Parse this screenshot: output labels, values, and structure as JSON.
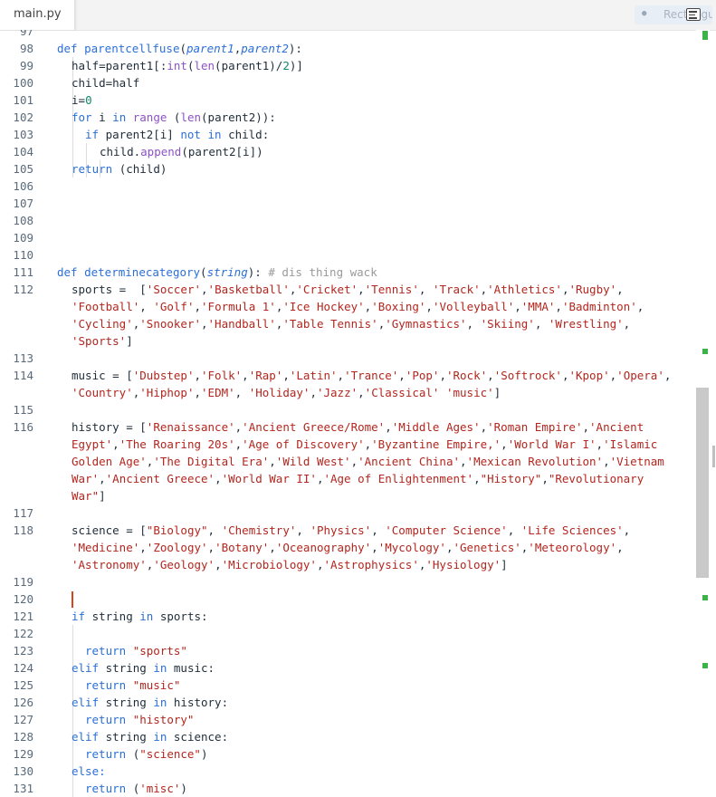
{
  "tabs": [
    {
      "label": "main.py",
      "active": true
    }
  ],
  "mini_pill_label": "Rectangula",
  "colors": {
    "keyword": "#2b6fd6",
    "string": "#b3261e",
    "number": "#0e8a6a",
    "builtin": "#8c52c7",
    "comment": "#9a9a9a",
    "cursor": "#d9421a",
    "marker": "#3cb34a"
  },
  "line_numbers": [
    "97",
    "98",
    "99",
    "100",
    "101",
    "102",
    "103",
    "104",
    "105",
    "106",
    "107",
    "108",
    "109",
    "110",
    "111",
    "112",
    "113",
    "114",
    "115",
    "116",
    "117",
    "118",
    "119",
    "120",
    "121",
    "122",
    "123",
    "124",
    "125",
    "126",
    "127",
    "128",
    "129",
    "130",
    "131"
  ],
  "code": {
    "l98": [
      "def ",
      "parentcellfuse",
      "(",
      "parent1",
      ",",
      "parent2",
      "):"
    ],
    "l99": [
      "half=parent1[:",
      "int",
      "(",
      "len",
      "(parent1)/",
      "2",
      ")]"
    ],
    "l100": [
      "child=half"
    ],
    "l101": [
      "i=",
      "0"
    ],
    "l102": [
      "for ",
      "i ",
      "in ",
      "range",
      " (",
      "len",
      "(parent2)):"
    ],
    "l103": [
      "if ",
      "parent2[i] ",
      "not in ",
      "child:"
    ],
    "l104": [
      "child.",
      "append",
      "(parent2[i])"
    ],
    "l105": [
      "return ",
      "(child)"
    ],
    "l111": [
      "def ",
      "determinecategory",
      "(",
      "string",
      "): ",
      "# dis thing wack"
    ],
    "l112a": [
      "sports =  [",
      "'Soccer'",
      ",",
      "'Basketball'",
      ",",
      "'Cricket'",
      ",",
      "'Tennis'",
      ", ",
      "'Track'",
      ",",
      "'Athletics'",
      ",",
      "'Rugby'",
      ","
    ],
    "l112b": [
      "'Football'",
      ", ",
      "'Golf'",
      ",",
      "'Formula 1'",
      ",",
      "'Ice Hockey'",
      ",",
      "'Boxing'",
      ",",
      "'Volleyball'",
      ",",
      "'MMA'",
      ",",
      "'Badminton'",
      ","
    ],
    "l112c": [
      "'Cycling'",
      ",",
      "'Snooker'",
      ",",
      "'Handball'",
      ",",
      "'Table Tennis'",
      ",",
      "'Gymnastics'",
      ", ",
      "'Skiing'",
      ", ",
      "'Wrestling'",
      ","
    ],
    "l112d": [
      "'Sports'",
      "]"
    ],
    "l114a": [
      "music = [",
      "'Dubstep'",
      ",",
      "'Folk'",
      ",",
      "'Rap'",
      ",",
      "'Latin'",
      ",",
      "'Trance'",
      ",",
      "'Pop'",
      ",",
      "'Rock'",
      ",",
      "'Softrock'",
      ",",
      "'Kpop'",
      ",",
      "'Opera'",
      ","
    ],
    "l114b": [
      "'Country'",
      ",",
      "'Hiphop'",
      ",",
      "'EDM'",
      ", ",
      "'Holiday'",
      ",",
      "'Jazz'",
      ",",
      "'Classical' 'music'",
      "]"
    ],
    "l116a": [
      "history = [",
      "'Renaissance'",
      ",",
      "'Ancient Greece/Rome'",
      ",",
      "'Middle Ages'",
      ",",
      "'Roman Empire'",
      ",",
      "'Ancient"
    ],
    "l116b": [
      "Egypt'",
      ",",
      "'The Roaring 20s'",
      ",",
      "'Age of Discovery'",
      ",",
      "'Byzantine Empire,'",
      ",",
      "'World War I'",
      ",",
      "'Islamic"
    ],
    "l116c": [
      "Golden Age'",
      ",",
      "'The Digital Era'",
      ",",
      "'Wild West'",
      ",",
      "'Ancient China'",
      ",",
      "'Mexican Revolution'",
      ",",
      "'Vietnam"
    ],
    "l116d": [
      "War'",
      ",",
      "'Ancient Greece'",
      ",",
      "'World War II'",
      ",",
      "'Age of Enlightenment'",
      ",",
      "\"History\"",
      ",",
      "\"Revolutionary"
    ],
    "l116e": [
      "War\"",
      "]"
    ],
    "l118a": [
      "science = [",
      "\"Biology\"",
      ", ",
      "'Chemistry'",
      ", ",
      "'Physics'",
      ", ",
      "'Computer Science'",
      ", ",
      "'Life Sciences'",
      ","
    ],
    "l118b": [
      "'Medicine'",
      ",",
      "'Zoology'",
      ",",
      "'Botany'",
      ",",
      "'Oceanography'",
      ",",
      "'Mycology'",
      ",",
      "'Genetics'",
      ",",
      "'Meteorology'",
      ","
    ],
    "l118c": [
      "'Astronomy'",
      ",",
      "'Geology'",
      ",",
      "'Microbiology'",
      ",",
      "'Astrophysics'",
      ",",
      "'Hysiology'",
      "]"
    ],
    "l121": [
      "if ",
      "string ",
      "in ",
      "sports:"
    ],
    "l123": [
      "return ",
      "\"sports\""
    ],
    "l124": [
      "elif ",
      "string ",
      "in ",
      "music:"
    ],
    "l125": [
      "return ",
      "\"music\""
    ],
    "l126": [
      "elif ",
      "string ",
      "in ",
      "history:"
    ],
    "l127": [
      "return ",
      "\"history\""
    ],
    "l128": [
      "elif ",
      "string ",
      "in ",
      "science:"
    ],
    "l129": [
      "return ",
      "(",
      "\"science\"",
      ")"
    ],
    "l130": [
      "else:"
    ],
    "l131": [
      "return ",
      "(",
      "'misc'",
      ")"
    ]
  }
}
